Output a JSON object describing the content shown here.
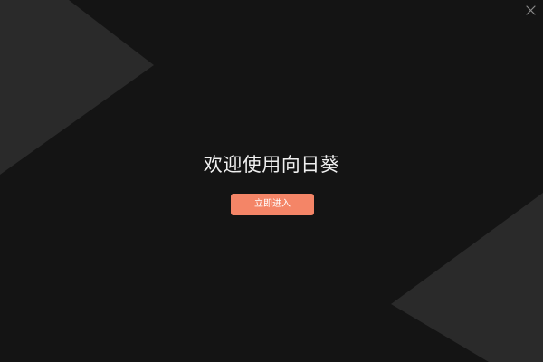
{
  "window": {
    "title": "欢迎使用向日葵",
    "close_icon": "close-icon"
  },
  "main": {
    "enter_button_label": "立即进入"
  },
  "colors": {
    "background": "#141414",
    "decoration": "#2a2a2a",
    "accent": "#f48567",
    "title_text": "#f0f0f0",
    "close_icon": "#8a8a8a"
  }
}
